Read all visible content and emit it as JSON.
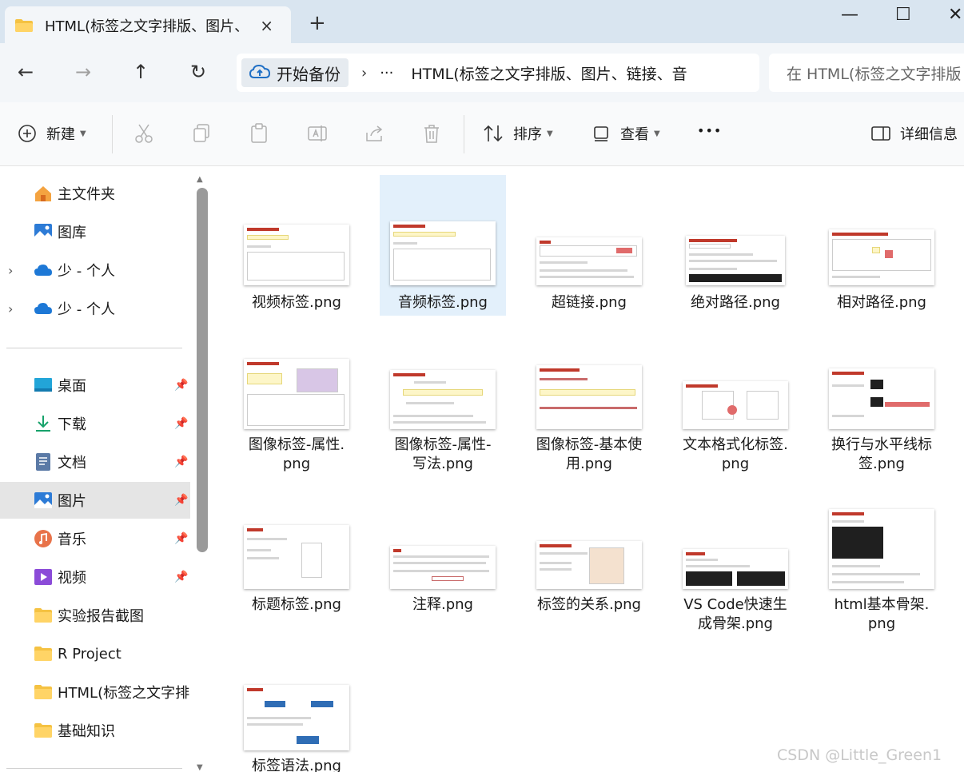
{
  "window": {
    "tab_title": "HTML(标签之文字排版、图片、",
    "close_tab": "×",
    "new_tab": "+",
    "minimize": "—",
    "maximize": "☐",
    "close": "✕"
  },
  "nav": {
    "back": "←",
    "forward": "→",
    "up": "↑",
    "refresh": "↻"
  },
  "address": {
    "start_label": "开始备份",
    "separator": "›",
    "more": "···",
    "current": "HTML(标签之文字排版、图片、链接、音"
  },
  "search": {
    "placeholder": "在 HTML(标签之文字排版"
  },
  "toolbar": {
    "new_label": "新建",
    "sort_label": "排序",
    "view_label": "查看",
    "more": "•••",
    "details_label": "详细信息"
  },
  "sidebar": {
    "items": [
      {
        "label": "主文件夹",
        "icon": "home-icon"
      },
      {
        "label": "图库",
        "icon": "gallery-icon"
      },
      {
        "label": "少 - 个人",
        "icon": "onedrive-icon"
      },
      {
        "label": "少 - 个人",
        "icon": "onedrive-icon"
      },
      {
        "label": "桌面",
        "icon": "desktop-icon"
      },
      {
        "label": "下载",
        "icon": "download-icon"
      },
      {
        "label": "文档",
        "icon": "document-icon"
      },
      {
        "label": "图片",
        "icon": "pictures-icon"
      },
      {
        "label": "音乐",
        "icon": "music-icon"
      },
      {
        "label": "视频",
        "icon": "video-icon"
      },
      {
        "label": "实验报告截图",
        "icon": "folder-icon"
      },
      {
        "label": "R Project",
        "icon": "folder-icon"
      },
      {
        "label": "HTML(标签之文字排",
        "icon": "folder-icon"
      },
      {
        "label": "基础知识",
        "icon": "folder-icon"
      }
    ],
    "chevron": "›",
    "pin": "📌"
  },
  "files": [
    {
      "line1": "视频标签.png",
      "line2": ""
    },
    {
      "line1": "音频标签.png",
      "line2": ""
    },
    {
      "line1": "超链接.png",
      "line2": ""
    },
    {
      "line1": "绝对路径.png",
      "line2": ""
    },
    {
      "line1": "相对路径.png",
      "line2": ""
    },
    {
      "line1": "图像标签-属性.",
      "line2": "png"
    },
    {
      "line1": "图像标签-属性-",
      "line2": "写法.png"
    },
    {
      "line1": "图像标签-基本使",
      "line2": "用.png"
    },
    {
      "line1": "文本格式化标签.",
      "line2": "png"
    },
    {
      "line1": "换行与水平线标",
      "line2": "签.png"
    },
    {
      "line1": "标题标签.png",
      "line2": ""
    },
    {
      "line1": "注释.png",
      "line2": ""
    },
    {
      "line1": "标签的关系.png",
      "line2": ""
    },
    {
      "line1": "VS Code快速生",
      "line2": "成骨架.png"
    },
    {
      "line1": "html基本骨架.",
      "line2": "png"
    },
    {
      "line1": "标签语法.png",
      "line2": ""
    }
  ],
  "watermark": "CSDN @Little_Green1",
  "colors": {
    "titlebar": "#d9e5f0",
    "selected_tile": "#e3f0fb",
    "selected_sidebar": "#e5e5e5",
    "folder": "#f5c242"
  }
}
